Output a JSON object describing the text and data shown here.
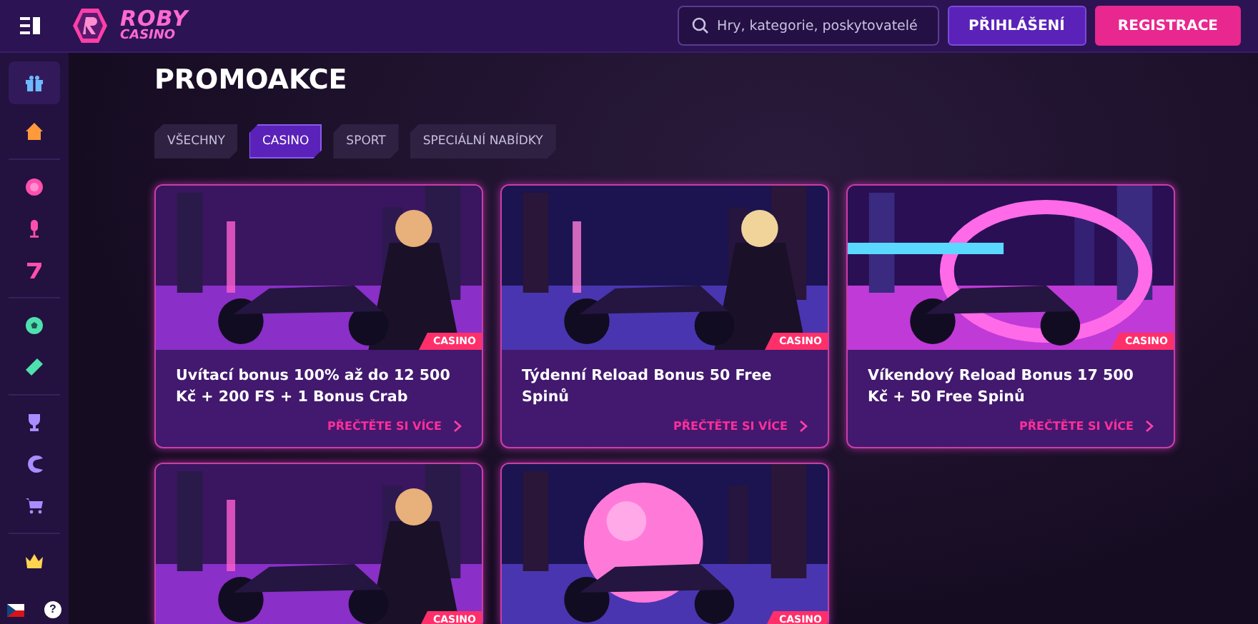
{
  "header": {
    "logo_top": "ROBY",
    "logo_bottom": "CASINO",
    "search": {
      "placeholder": "Hry, kategorie, poskytovatelé"
    },
    "login": "PŘIHLÁŠENÍ",
    "register": "REGISTRACE"
  },
  "sidebar": {
    "help": "?"
  },
  "page": {
    "title": "PROMOAKCE"
  },
  "tabs": [
    {
      "label": "VŠECHNY",
      "selected": false
    },
    {
      "label": "CASINO",
      "selected": true
    },
    {
      "label": "SPORT",
      "selected": false
    },
    {
      "label": "SPECIÁLNÍ NABÍDKY",
      "selected": false
    }
  ],
  "promos": [
    {
      "tag": "CASINO",
      "title": "Uvítací bonus 100% až do 12 500 Kč + 200 FS + 1 Bonus Crab",
      "link": "PŘEČTĚTE SI VÍCE"
    },
    {
      "tag": "CASINO",
      "title": "Týdenní Reload Bonus 50 Free Spinů",
      "link": "PŘEČTĚTE SI VÍCE"
    },
    {
      "tag": "CASINO",
      "title": "Víkendový Reload Bonus 17 500 Kč + 50 Free Spinů",
      "link": "PŘEČTĚTE SI VÍCE"
    },
    {
      "tag": "CASINO"
    },
    {
      "tag": "CASINO"
    }
  ]
}
